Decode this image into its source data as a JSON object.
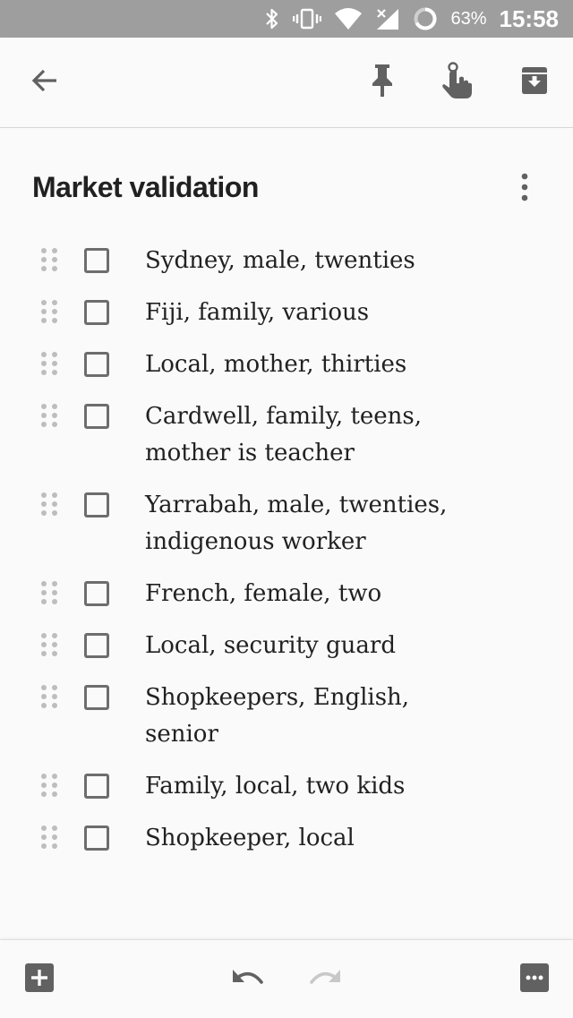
{
  "status_bar": {
    "battery_percent": "63%",
    "time": "15:58",
    "icons": [
      "bluetooth-icon",
      "vibrate-icon",
      "wifi-icon",
      "cellular-signal-icon",
      "battery-icon"
    ]
  },
  "toolbar": {
    "icons": [
      "back-arrow-icon",
      "pin-icon",
      "reminder-icon",
      "archive-icon"
    ]
  },
  "note": {
    "title": "Market validation",
    "items": [
      {
        "text": "Sydney, male, twenties",
        "checked": false
      },
      {
        "text": "Fiji, family, various",
        "checked": false
      },
      {
        "text": "Local, mother, thirties",
        "checked": false
      },
      {
        "text": "Cardwell, family, teens, mother is teacher",
        "checked": false
      },
      {
        "text": "Yarrabah, male, twenties, indigenous worker",
        "checked": false
      },
      {
        "text": "French, female, two",
        "checked": false
      },
      {
        "text": "Local, security guard",
        "checked": false
      },
      {
        "text": "Shopkeepers, English, senior",
        "checked": false
      },
      {
        "text": "Family, local, two kids",
        "checked": false
      },
      {
        "text": "Shopkeeper, local",
        "checked": false
      }
    ]
  },
  "bottom_bar": {
    "icons": [
      "add-box-icon",
      "undo-icon",
      "redo-icon",
      "more-options-icon"
    ],
    "redo_enabled": false
  },
  "colors": {
    "status_bar_bg": "#9e9e9e",
    "background": "#fafafa",
    "icon_dark": "#616161",
    "icon_disabled": "#c8c8c8",
    "text": "#212121"
  }
}
